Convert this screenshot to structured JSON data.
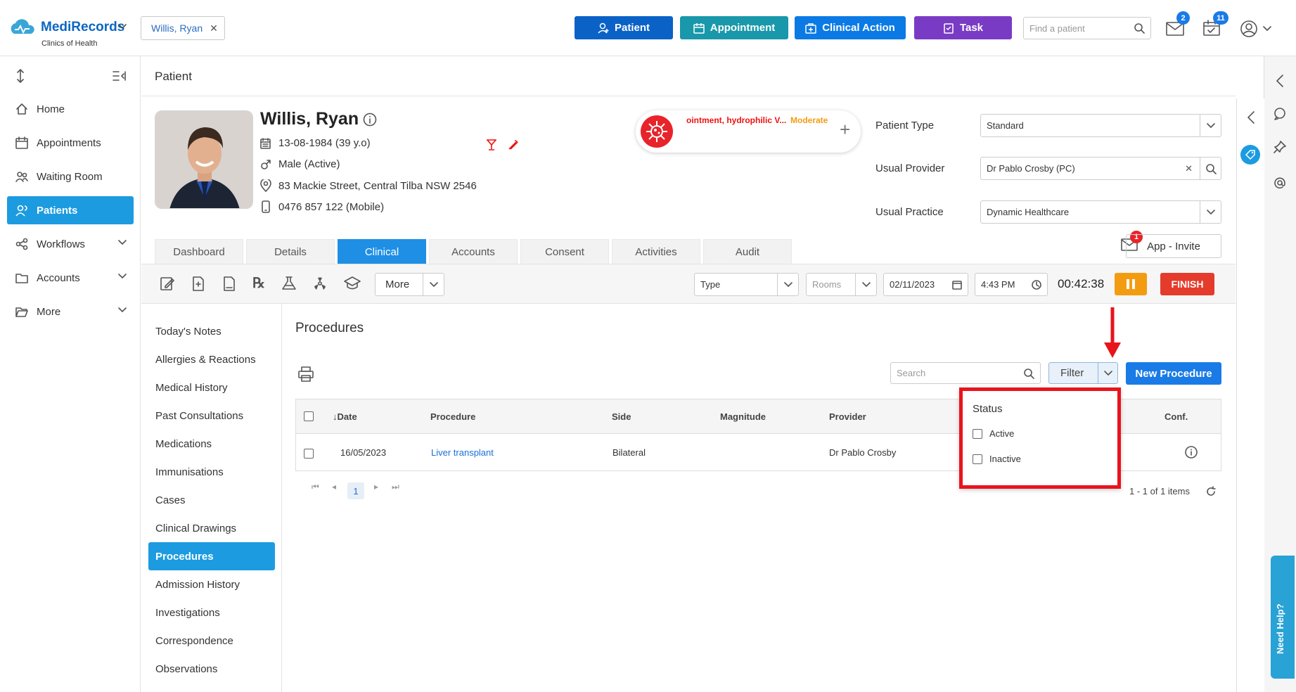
{
  "app": {
    "brand": "MediRecords",
    "subtitle": "Clinics of Health"
  },
  "patient_chip": {
    "name": "Willis, Ryan"
  },
  "top_buttons": [
    {
      "label": "Patient",
      "color": "#0a62c7"
    },
    {
      "label": "Appointment",
      "color": "#1898aa"
    },
    {
      "label": "Clinical Action",
      "color": "#0b7ae5"
    },
    {
      "label": "Task",
      "color": "#7a3bc4"
    }
  ],
  "top_search": {
    "placeholder": "Find a patient"
  },
  "badges": {
    "mail": "2",
    "tasks": "11",
    "patient_mail": "1"
  },
  "sidebar": {
    "items": [
      {
        "label": "Home"
      },
      {
        "label": "Appointments"
      },
      {
        "label": "Waiting Room"
      },
      {
        "label": "Patients"
      },
      {
        "label": "Workflows"
      },
      {
        "label": "Accounts"
      },
      {
        "label": "More"
      }
    ]
  },
  "breadcrumb": "Patient",
  "patient": {
    "name": "Willis, Ryan",
    "dob": "13-08-1984 (39 y.o)",
    "gender": "Male (Active)",
    "address": "83 Mackie Street, Central Tilba NSW 2546",
    "phone": "0476 857 122 (Mobile)"
  },
  "allergy": {
    "text": "ointment, hydrophilic V...",
    "severity": "Moderate"
  },
  "fields": {
    "patient_type_label": "Patient Type",
    "patient_type_value": "Standard",
    "usual_provider_label": "Usual Provider",
    "usual_provider_value": "Dr Pablo Crosby (PC)",
    "usual_practice_label": "Usual Practice",
    "usual_practice_value": "Dynamic Healthcare"
  },
  "tabs": [
    {
      "label": "Dashboard"
    },
    {
      "label": "Details"
    },
    {
      "label": "Clinical"
    },
    {
      "label": "Accounts"
    },
    {
      "label": "Consent"
    },
    {
      "label": "Activities"
    },
    {
      "label": "Audit"
    }
  ],
  "app_invite": "App - Invite",
  "toolbar": {
    "more": "More",
    "type_placeholder": "Type",
    "rooms_placeholder": "Rooms",
    "date": "02/11/2023",
    "time": "4:43 PM",
    "timer": "00:42:38",
    "finish": "FINISH",
    "pause_color": "#f39c12",
    "finish_color": "#e53b2c"
  },
  "notes_menu": [
    {
      "label": "Today's Notes"
    },
    {
      "label": "Allergies & Reactions"
    },
    {
      "label": "Medical History"
    },
    {
      "label": "Past Consultations"
    },
    {
      "label": "Medications"
    },
    {
      "label": "Immunisations"
    },
    {
      "label": "Cases"
    },
    {
      "label": "Clinical Drawings"
    },
    {
      "label": "Procedures"
    },
    {
      "label": "Admission History"
    },
    {
      "label": "Investigations"
    },
    {
      "label": "Correspondence"
    },
    {
      "label": "Observations"
    }
  ],
  "procedures": {
    "title": "Procedures",
    "search_placeholder": "Search",
    "filter_label": "Filter",
    "new_button": "New Procedure",
    "columns": [
      "Date",
      "Procedure",
      "Side",
      "Magnitude",
      "Provider",
      "Conf."
    ],
    "rows": [
      {
        "date": "16/05/2023",
        "procedure": "Liver transplant",
        "side": "Bilateral",
        "magnitude": "",
        "provider": "Dr Pablo Crosby"
      }
    ],
    "page": "1",
    "items_summary": "1 - 1 of 1 items"
  },
  "filter_popup": {
    "title": "Status",
    "options": [
      {
        "label": "Active",
        "checked": false
      },
      {
        "label": "Inactive",
        "checked": false
      }
    ]
  },
  "need_help": "Need Help?"
}
